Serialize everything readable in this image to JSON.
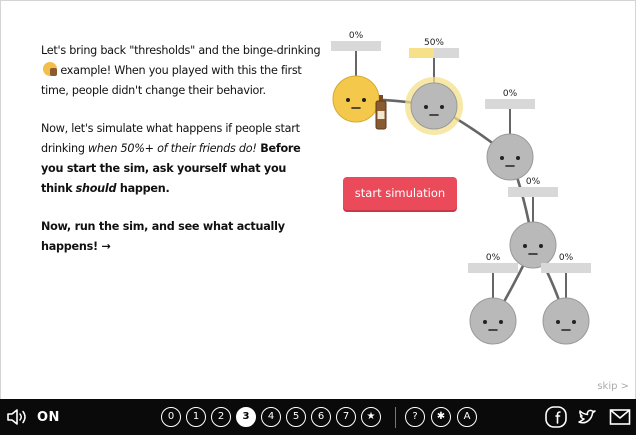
{
  "intro": {
    "p1_a": "Let's bring back \"thresholds\" and the binge-drinking",
    "p1_b": "example! When you played with this the first time, people didn't change their behavior.",
    "p2_a": "Now, let's simulate what happens if people start drinking",
    "p2_em": "when 50%+ of their friends do!",
    "p2_b": " Before you start the sim, ask yourself what you think",
    "p2_em2": "should",
    "p2_c": " happen.",
    "p3": "Now, run the sim, and see what actually happens! →"
  },
  "simulation": {
    "button_label": "start simulation",
    "nodes": [
      {
        "id": "drinker",
        "percent": "0%",
        "state": "drinking",
        "threshold_filled": 0
      },
      {
        "id": "n1",
        "percent": "50%",
        "state": "sober",
        "threshold_filled": 0.5
      },
      {
        "id": "n2",
        "percent": "0%",
        "state": "sober",
        "threshold_filled": 0
      },
      {
        "id": "n3",
        "percent": "0%",
        "state": "sober",
        "threshold_filled": 0
      },
      {
        "id": "n4",
        "percent": "0%",
        "state": "sober",
        "threshold_filled": 0
      },
      {
        "id": "n5",
        "percent": "0%",
        "state": "sober",
        "threshold_filled": 0
      },
      {
        "id": "n6",
        "percent": "0%",
        "state": "sober",
        "threshold_filled": 0
      }
    ],
    "colors": {
      "drinking": "#f4c84a",
      "sober": "#b9b9b9",
      "highlight": "#f6e08a",
      "bar_bg": "#d8d8d8",
      "bar_fill": "#f6e08a"
    }
  },
  "skip_label": "skip >",
  "bottom_bar": {
    "sound_label": "ON",
    "chapters": [
      "0",
      "1",
      "2",
      "3",
      "4",
      "5",
      "6",
      "7",
      "★"
    ],
    "active_chapter": 3,
    "extras": [
      "?",
      "✱",
      "A"
    ],
    "social": [
      "facebook-icon",
      "twitter-icon",
      "email-icon"
    ]
  },
  "colors": {
    "accent": "#ea4a5a",
    "bar": "#0a0a0a"
  }
}
